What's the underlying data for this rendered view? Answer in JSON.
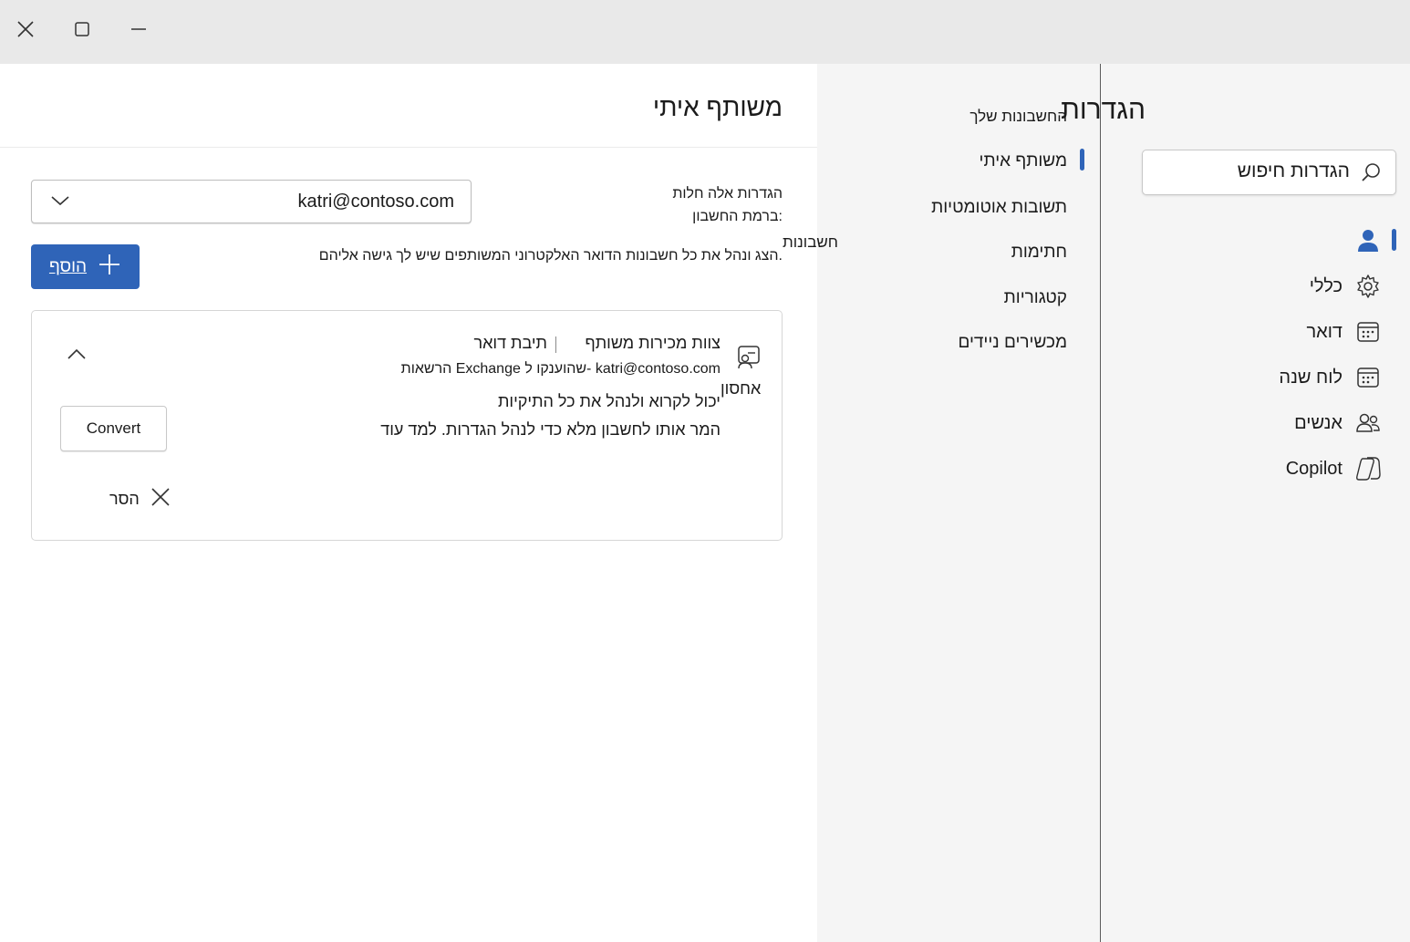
{
  "window": {
    "close_icon": "close-icon",
    "maximize_icon": "maximize-icon",
    "minimize_icon": "minimize-icon"
  },
  "settings": {
    "title": "הגדרות",
    "search_placeholder": "הגדרות חיפוש"
  },
  "rail": {
    "items": [
      {
        "label": "",
        "icon": "person-icon",
        "active": true
      },
      {
        "label": "כללי",
        "icon": "gear-icon"
      },
      {
        "label": "דואר",
        "icon": "mail-calendar-icon"
      },
      {
        "label": "לוח שנה",
        "icon": "calendar-icon"
      },
      {
        "label": "אנשים",
        "icon": "people-icon"
      },
      {
        "label": "Copilot",
        "icon": "copilot-icon"
      }
    ]
  },
  "nav": {
    "header": "החשבונות שלך",
    "items": [
      {
        "label": "משותף איתי",
        "active": true
      },
      {
        "label": "תשובות אוטומטיות"
      },
      {
        "label": "חתימות"
      },
      {
        "label": "קטגוריות"
      },
      {
        "label": "מכשירים ניידים"
      }
    ]
  },
  "page": {
    "title": "משותף איתי",
    "applies_label": "הגדרות אלה חלות ברמת החשבון:",
    "account_value": "katri@contoso.com",
    "section_label": "חשבונות",
    "description": "הצג ונהל את כל חשבונות הדואר האלקטרוני המשותפים שיש לך גישה אליהם.",
    "add_button": "הוסף"
  },
  "mailbox": {
    "name": "צוות מכירות משותף",
    "type": "תיבת דואר",
    "permissions": "הרשאות Exchange שהוענקו ל- katri@contoso.com",
    "storage": "אחסון",
    "access": "יכול לקרוא ולנהל את כל התיקיות",
    "convert_desc": "המר אותו לחשבון מלא כדי לנהל הגדרות. למד עוד",
    "convert_button": "Convert",
    "remove_button": "הסר"
  },
  "colors": {
    "accent": "#2f64b8",
    "rail_bg": "#f5f5f5",
    "titlebar_bg": "#e9e9e9"
  }
}
